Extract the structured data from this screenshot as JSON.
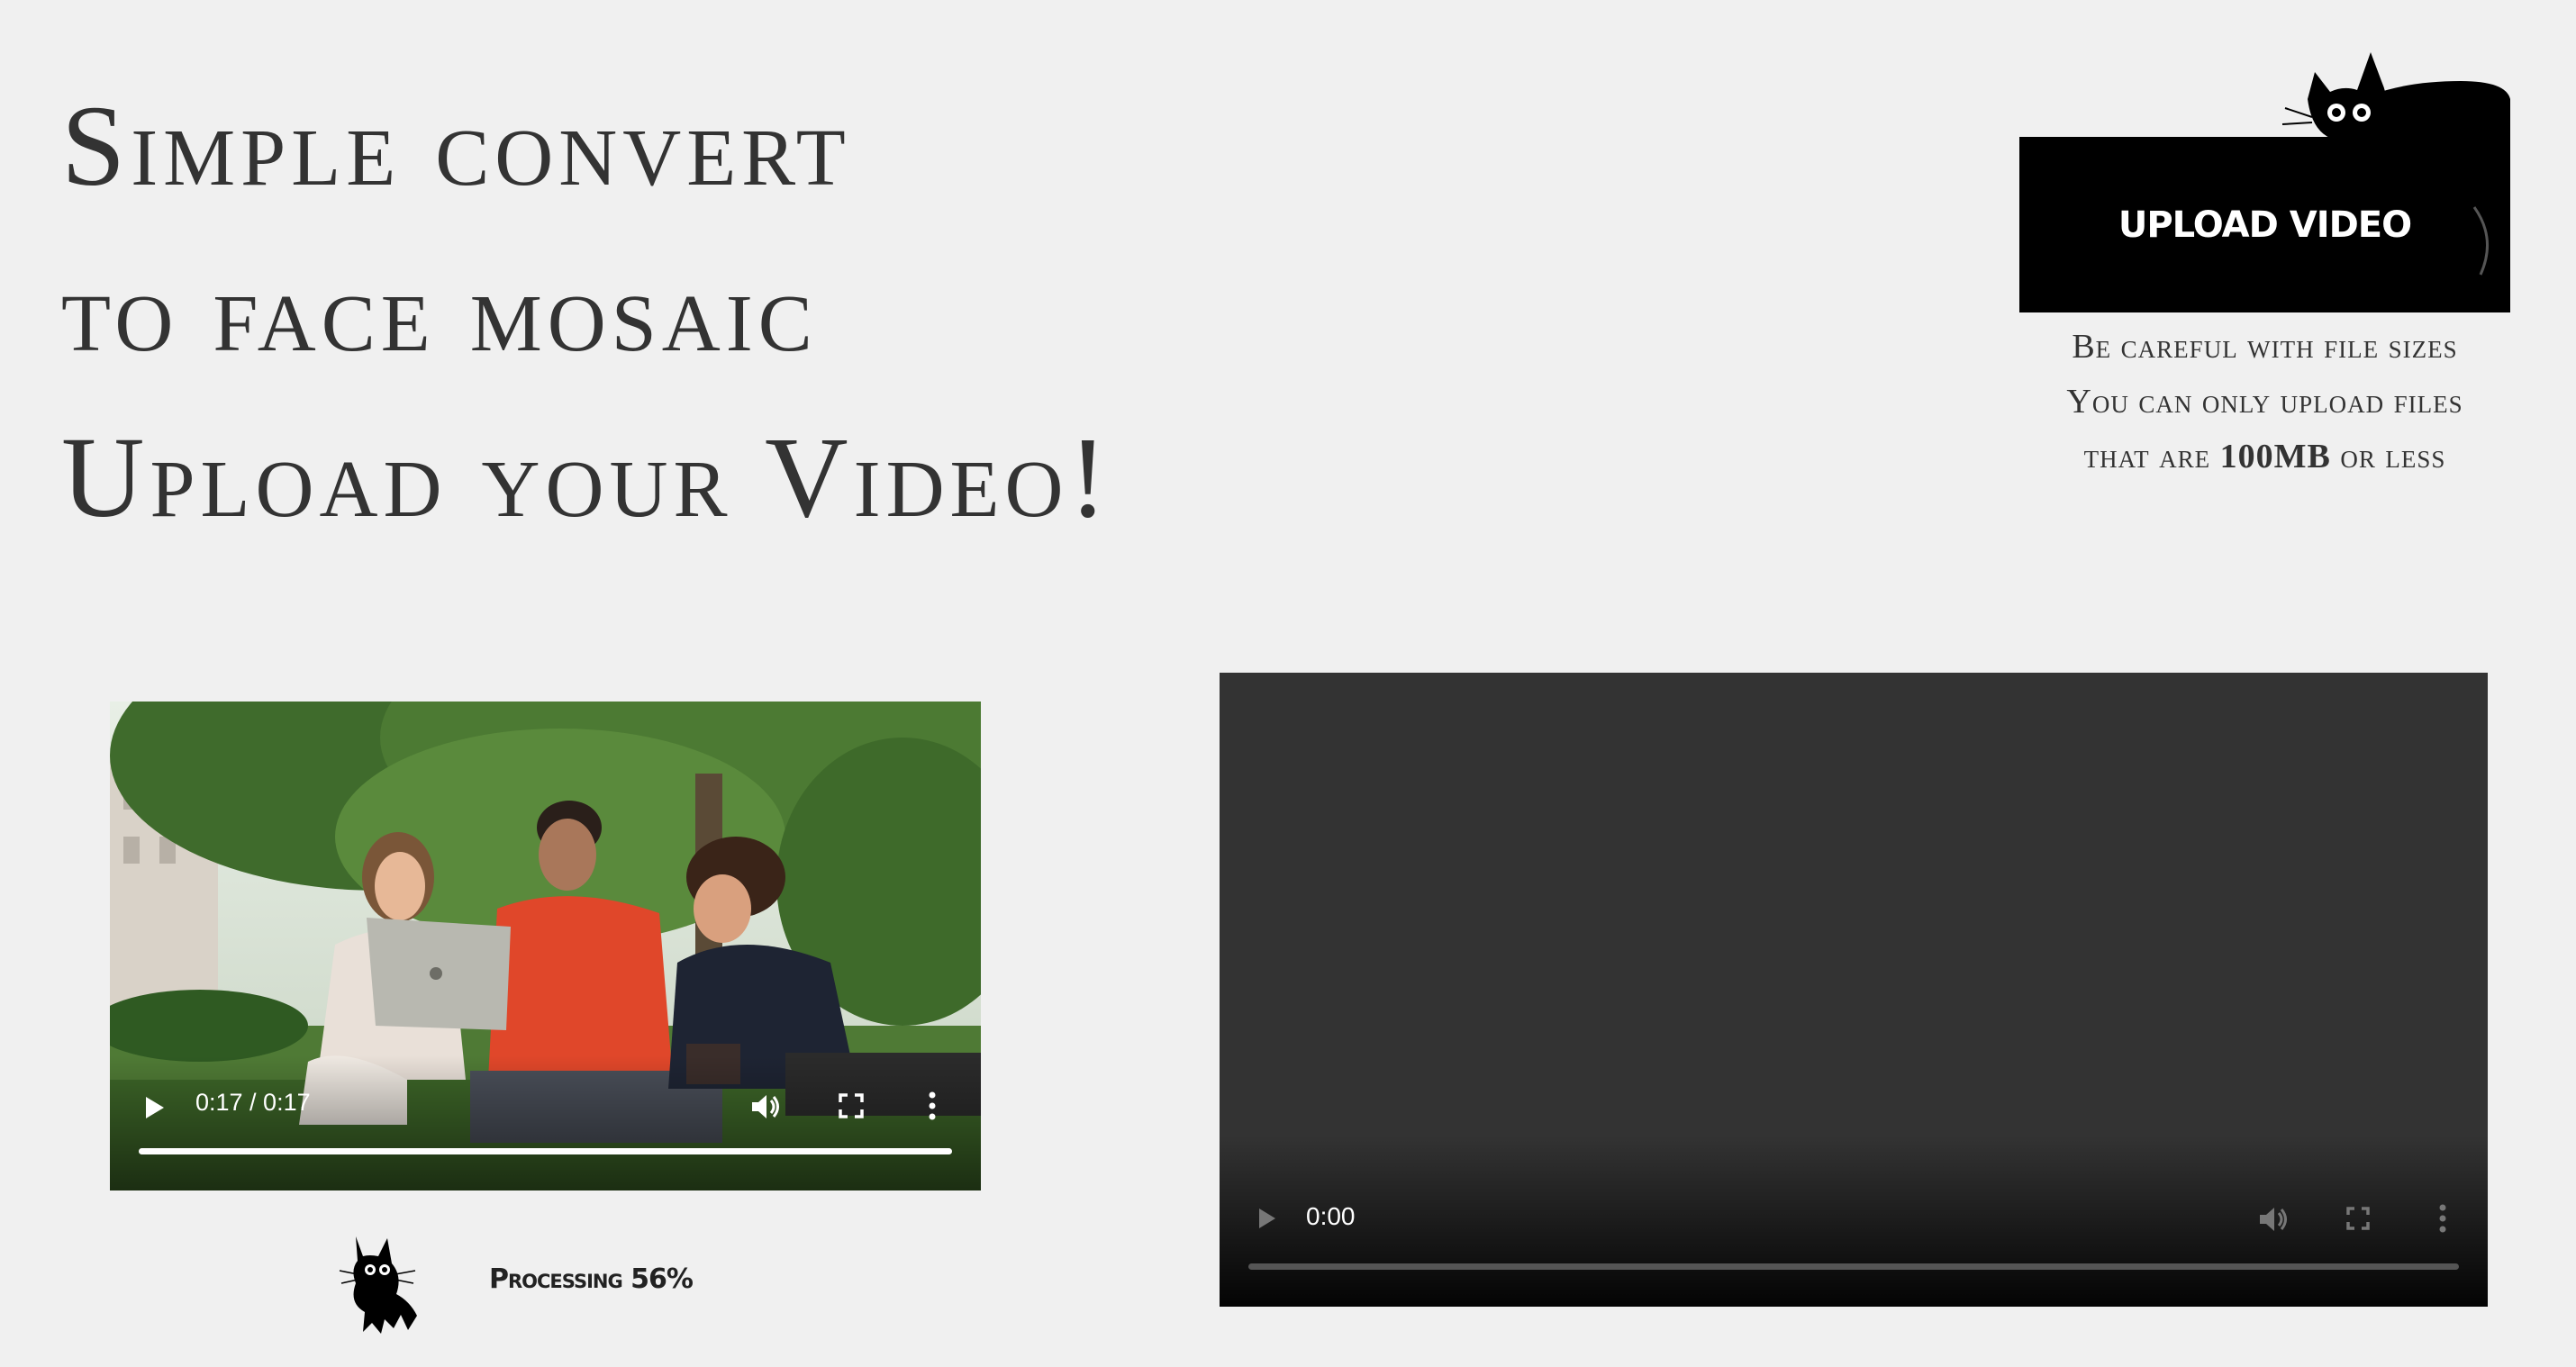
{
  "headline": {
    "line1": "Simple convert",
    "line2": "to face mosaic",
    "line3": "Upload your Video!"
  },
  "upload": {
    "button_label": "UPLOAD VIDEO",
    "note_line1": "Be careful with file sizes",
    "note_line2": "You can only upload files",
    "note_line3_prefix": "that are ",
    "note_line3_bold": "100MB",
    "note_line3_suffix": " or less"
  },
  "source_video": {
    "time": "0:17 / 0:17",
    "progress": 1.0
  },
  "output_video": {
    "time": "0:00",
    "progress": 0.0
  },
  "status": {
    "label": "Processing 56%"
  },
  "colors": {
    "background": "#f0f0f0",
    "text": "#333333",
    "button": "#000000",
    "player_empty": "#333333"
  },
  "icons": [
    "cat-icon",
    "play-icon",
    "volume-icon",
    "fullscreen-icon",
    "more-options-icon",
    "cat-walking-icon"
  ]
}
